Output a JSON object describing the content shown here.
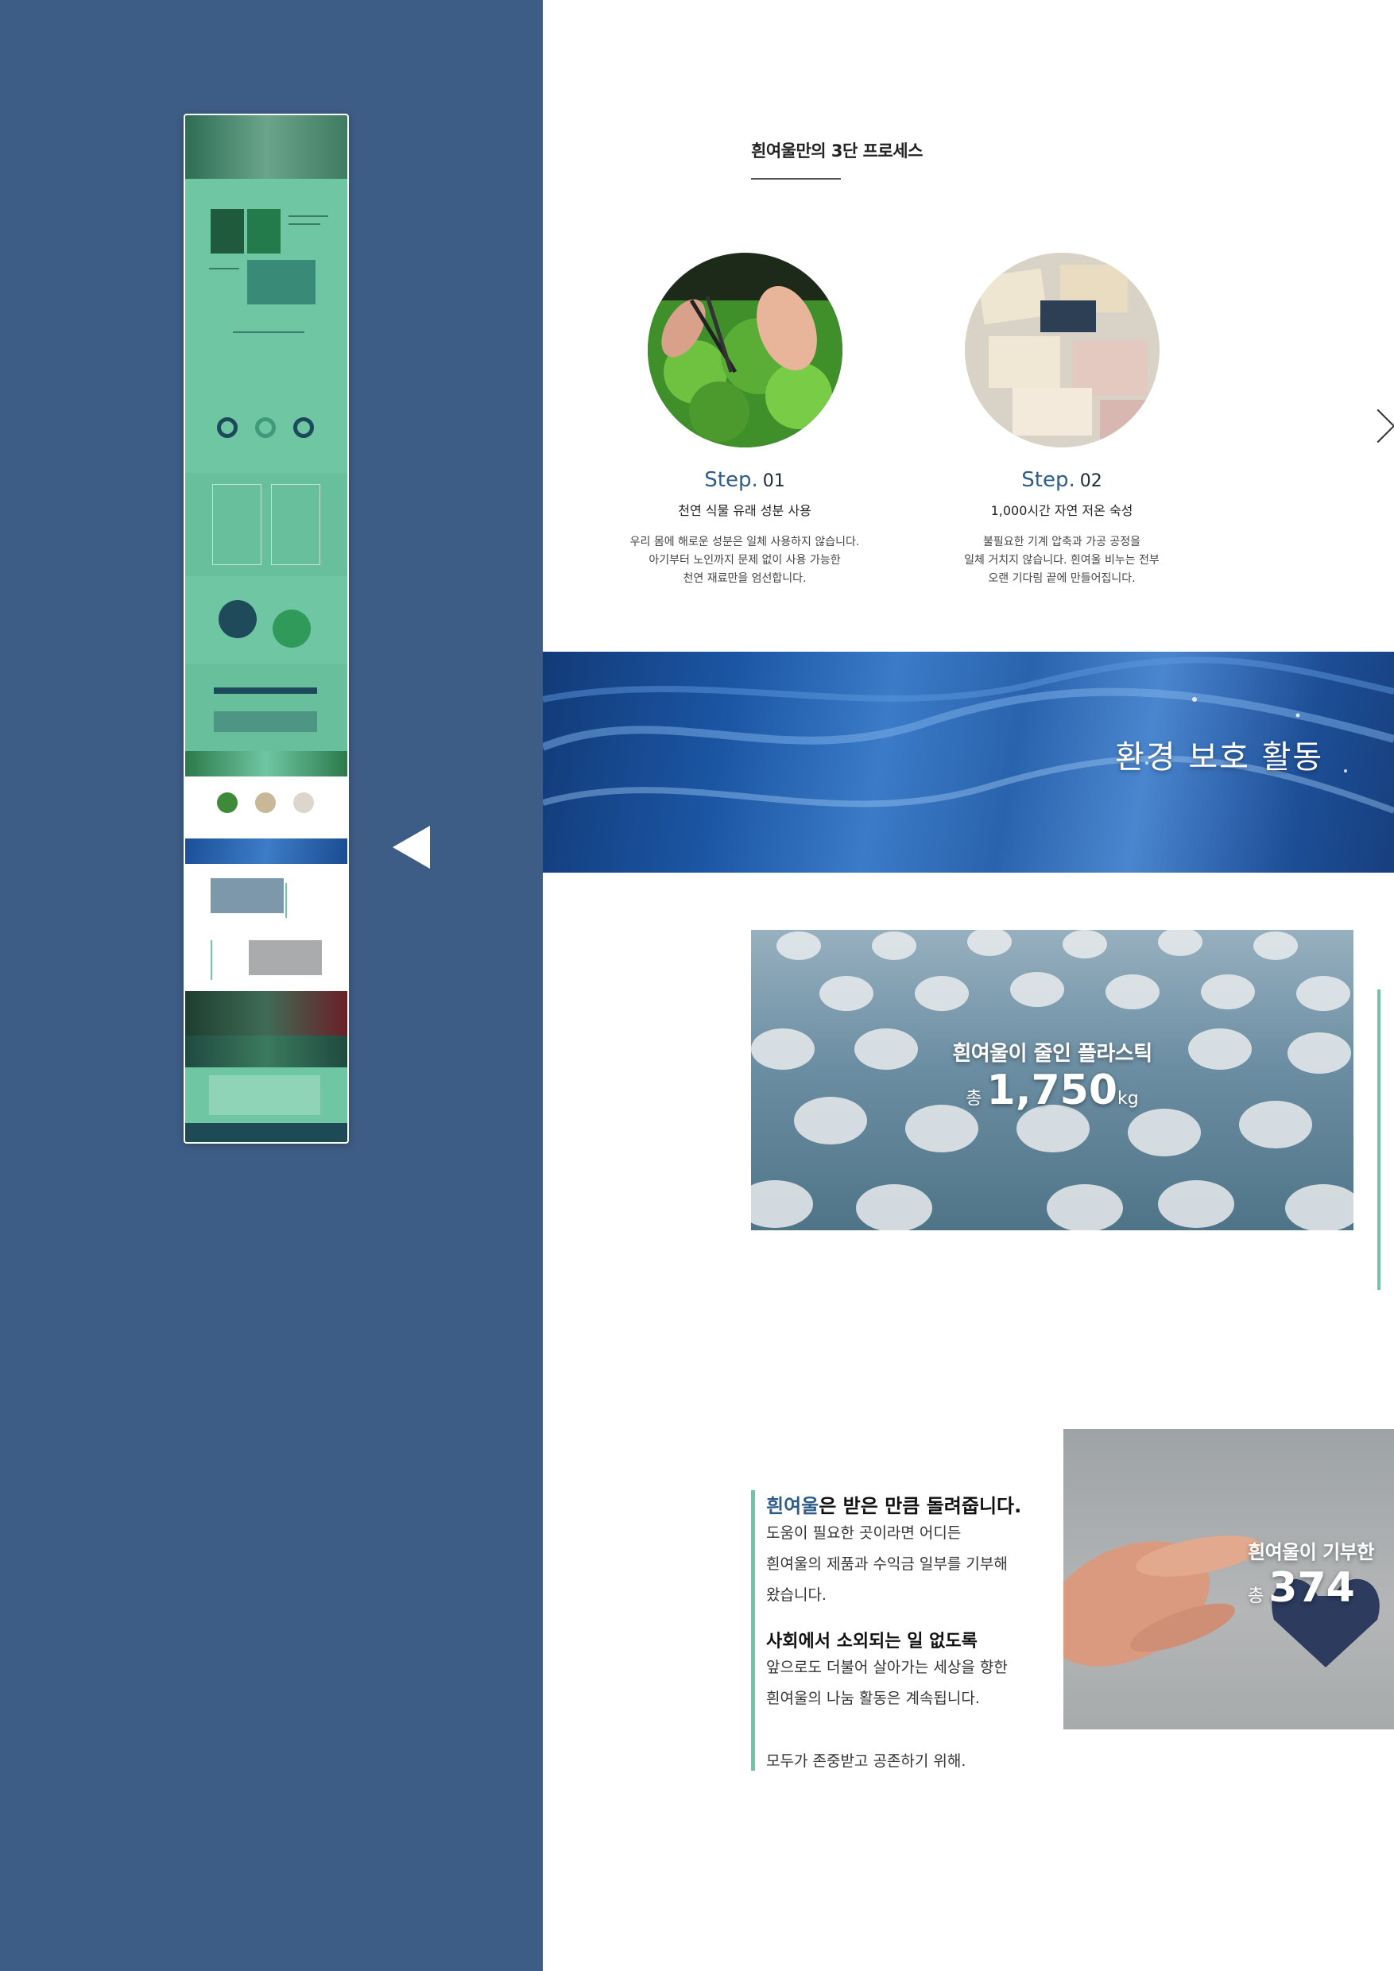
{
  "process": {
    "title": "흰여울만의 3단 프로세스",
    "steps": [
      {
        "label": "Step.",
        "number": "01",
        "subtitle": "천연 식물 유래 성분 사용",
        "desc": [
          "우리 몸에 해로운 성분은 일체 사용하지 않습니다.",
          "아기부터 노인까지 문제 없이 사용 가능한",
          "천연 재료만을 엄선합니다."
        ]
      },
      {
        "label": "Step.",
        "number": "02",
        "subtitle": "1,000시간 자연 저온 숙성",
        "desc": [
          "불필요한 기계 압축과 가공 공정을",
          "일체 거치지 않습니다. 흰여울 비누는 전부",
          "오랜 기다림 끝에 만들어집니다."
        ]
      }
    ]
  },
  "environment": {
    "banner_title": "환경 보호 활동",
    "plastic_title": "흰여울이 줄인 플라스틱",
    "plastic_prefix": "총",
    "plastic_value": "1,750",
    "plastic_unit": "kg"
  },
  "donation": {
    "brand": "흰여울",
    "heading_rest": "은 받은 만큼 돌려줍니다.",
    "body1": [
      "도움이 필요한 곳이라면 어디든",
      "흰여울의 제품과 수익금 일부를 기부해",
      "왔습니다."
    ],
    "heading2": "사회에서 소외되는 일 없도록",
    "body2": [
      "앞으로도 더불어 살아가는 세상을 향한",
      "흰여울의 나눔 활동은 계속됩니다."
    ],
    "closing": "모두가 존중받고 공존하기 위해.",
    "donate_title": "흰여울이 기부한",
    "donate_prefix": "총",
    "donate_value": "374"
  },
  "colors": {
    "background": "#3e5d86",
    "accent_green": "#6ec6a2",
    "brand_blue": "#2f5d8a"
  },
  "icons": {
    "navigator_back": "triangle-left-icon",
    "step_next": "chevron-right-icon"
  }
}
